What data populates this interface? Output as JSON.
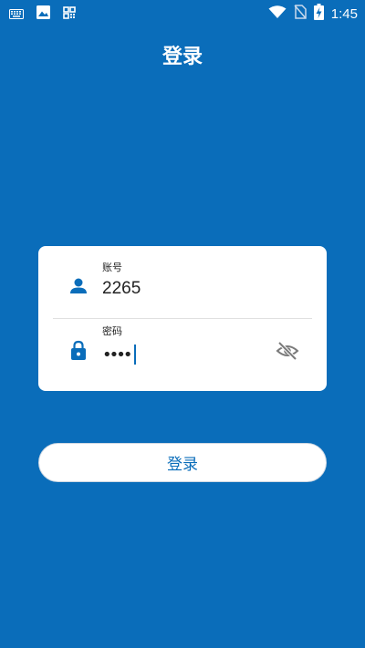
{
  "status_bar": {
    "time": "1:45",
    "left_icons": [
      "keyboard-icon",
      "image-icon",
      "qr-code-icon"
    ],
    "right_icons": [
      "wifi-icon",
      "no-sim-icon",
      "battery-charging-icon"
    ]
  },
  "page": {
    "title": "登录"
  },
  "form": {
    "account": {
      "label": "账号",
      "value": "2265",
      "icon": "person-icon"
    },
    "password": {
      "label": "密码",
      "masked_value": "••••",
      "icon": "lock-icon",
      "toggle_icon": "eye-off-icon"
    }
  },
  "actions": {
    "login_label": "登录"
  },
  "colors": {
    "background": "#0a6dba",
    "accent": "#0a6dba",
    "card": "#ffffff"
  }
}
